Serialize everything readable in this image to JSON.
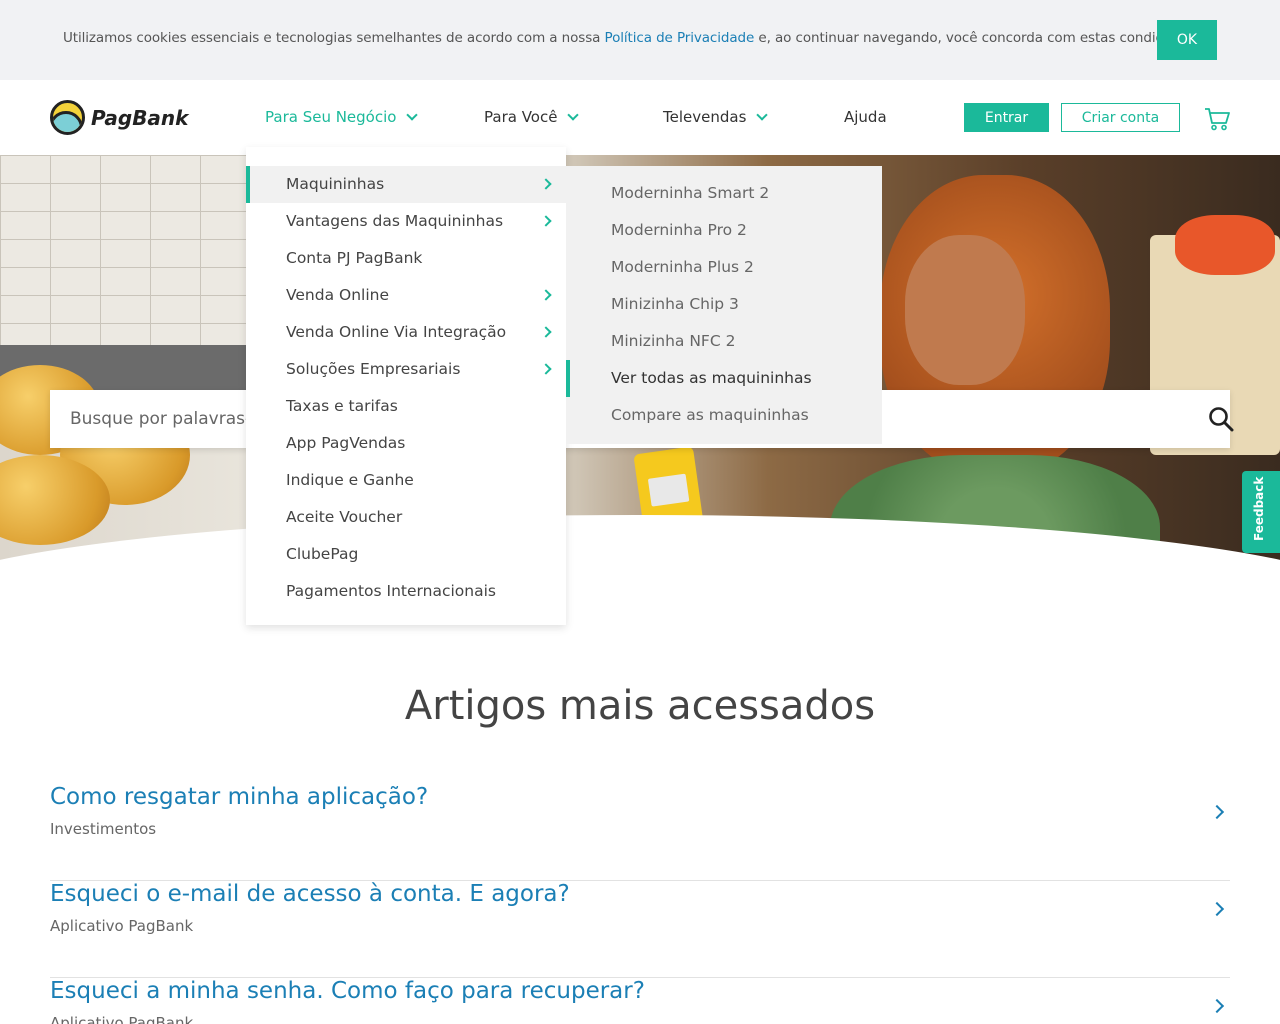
{
  "cookie": {
    "text_before": "Utilizamos cookies essenciais e tecnologias semelhantes de acordo com a nossa ",
    "link": "Política de Privacidade",
    "text_after": " e, ao continuar navegando, você concorda com estas condições.",
    "ok_label": "OK"
  },
  "header": {
    "logo_text": "PagBank",
    "nav": [
      {
        "label": "Para Seu Negócio"
      },
      {
        "label": "Para Você"
      },
      {
        "label": "Televendas"
      },
      {
        "label": "Ajuda"
      }
    ],
    "entrar_label": "Entrar",
    "criar_label": "Criar conta"
  },
  "menu": {
    "items": [
      {
        "label": "Maquininhas"
      },
      {
        "label": "Vantagens das Maquininhas"
      },
      {
        "label": "Conta PJ PagBank"
      },
      {
        "label": "Venda Online"
      },
      {
        "label": "Venda Online Via Integração"
      },
      {
        "label": "Soluções Empresariais"
      },
      {
        "label": "Taxas e tarifas"
      },
      {
        "label": "App PagVendas"
      },
      {
        "label": "Indique e Ganhe"
      },
      {
        "label": "Aceite Voucher"
      },
      {
        "label": "ClubePag"
      },
      {
        "label": "Pagamentos Internacionais"
      }
    ],
    "sub_items": [
      {
        "label": "Moderninha Smart 2"
      },
      {
        "label": "Moderninha Pro 2"
      },
      {
        "label": "Moderninha Plus 2"
      },
      {
        "label": "Minizinha Chip 3"
      },
      {
        "label": "Minizinha NFC 2"
      },
      {
        "label": "Ver todas as maquininhas"
      },
      {
        "label": "Compare as maquininhas"
      }
    ]
  },
  "search": {
    "placeholder": "Busque por palavras-chave"
  },
  "feedback_label": "Feedback",
  "articles_section": {
    "title": "Artigos mais acessados",
    "items": [
      {
        "title": "Como resgatar minha aplicação?",
        "category": "Investimentos"
      },
      {
        "title": "Esqueci o e-mail de acesso à conta. E agora?",
        "category": "Aplicativo PagBank"
      },
      {
        "title": "Esqueci a minha senha. Como faço para recuperar?",
        "category": "Aplicativo PagBank"
      }
    ]
  },
  "colors": {
    "accent": "#1bb99a",
    "link": "#1b7fb5",
    "cookie_bg": "#f1f2f4"
  }
}
